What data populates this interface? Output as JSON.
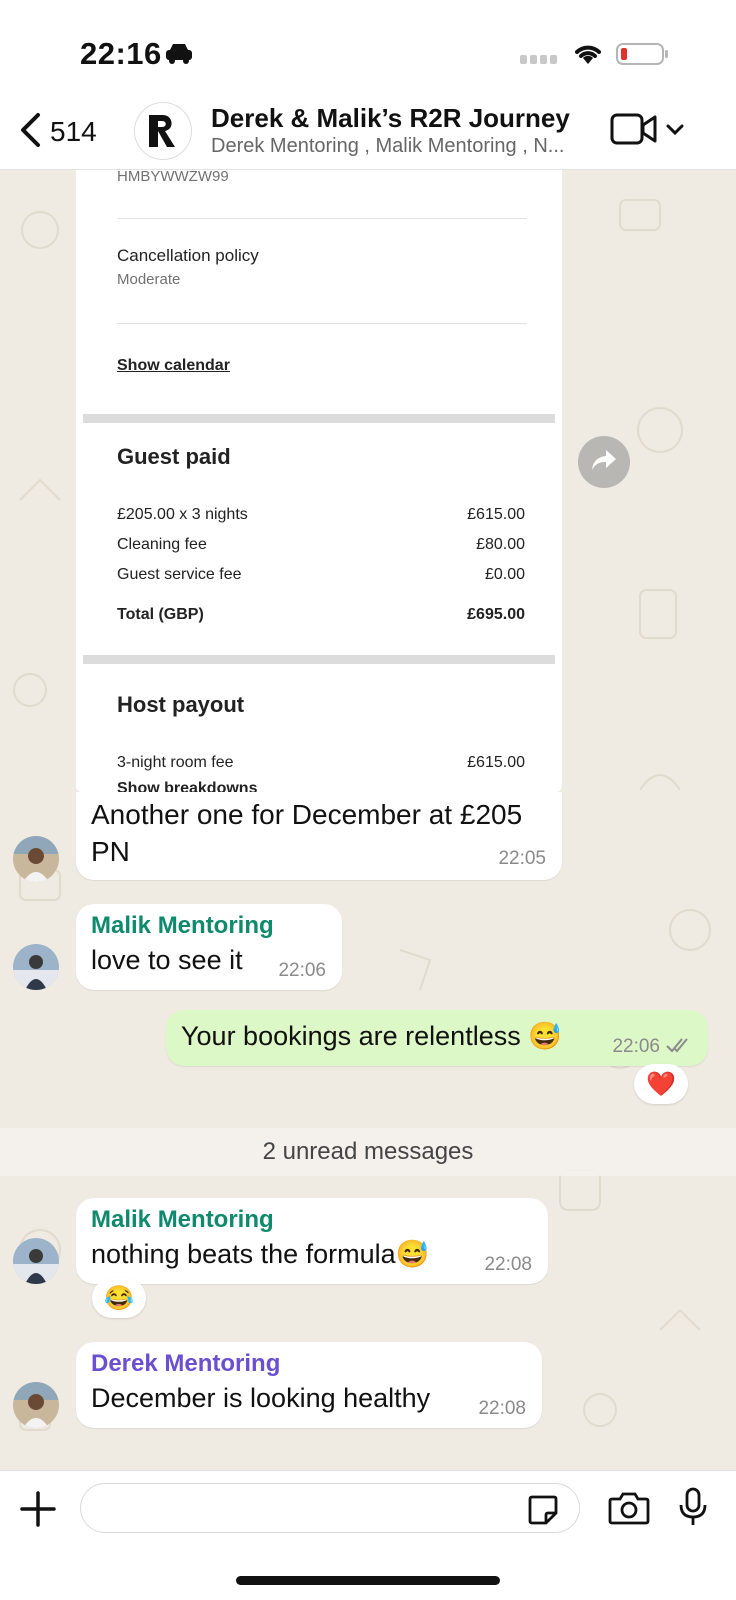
{
  "status": {
    "time": "22:16"
  },
  "header": {
    "back_count": "514",
    "title": "Derek & Malik’s R2R Journey",
    "subtitle": "Derek Mentoring , Malik Mentoring , N..."
  },
  "card": {
    "confirmation_code": "HMBYWWZW99",
    "cancellation_label": "Cancellation policy",
    "cancellation_value": "Moderate",
    "show_calendar": "Show calendar",
    "guest_paid": {
      "heading": "Guest paid",
      "rows": [
        {
          "label": "£205.00 x 3 nights",
          "value": "£615.00"
        },
        {
          "label": "Cleaning fee",
          "value": "£80.00"
        },
        {
          "label": "Guest service fee",
          "value": "£0.00"
        }
      ],
      "total_label": "Total (GBP)",
      "total_value": "£695.00"
    },
    "host_payout": {
      "heading": "Host payout",
      "row_label": "3-night room fee",
      "row_value": "£615.00",
      "show_breakdowns": "Show breakdowns"
    }
  },
  "messages": [
    {
      "id": "m1",
      "text": "Another one for December at £205 PN",
      "time": "22:05"
    },
    {
      "id": "m2",
      "sender": "Malik Mentoring",
      "text": "love to see it",
      "time": "22:06"
    },
    {
      "id": "m3",
      "text": "Your bookings are relentless 😅",
      "time": "22:06",
      "reaction": "❤️"
    },
    {
      "id": "m4",
      "sender": "Malik Mentoring",
      "text": "nothing beats the formula😅",
      "time": "22:08",
      "reaction": "😂"
    },
    {
      "id": "m5",
      "sender": "Derek Mentoring",
      "text": "December is looking healthy",
      "time": "22:08"
    }
  ],
  "unread_label": "2 unread messages",
  "colors": {
    "malik": "#0f8a6c",
    "derek": "#6a4fd0",
    "outgoing": "#dcf8c6",
    "tick": "#8a8a8a"
  },
  "icons": [
    "back-chevron-icon",
    "video-call-icon",
    "forward-icon",
    "plus-icon",
    "sticker-icon",
    "camera-icon",
    "mic-icon",
    "double-tick-icon"
  ]
}
